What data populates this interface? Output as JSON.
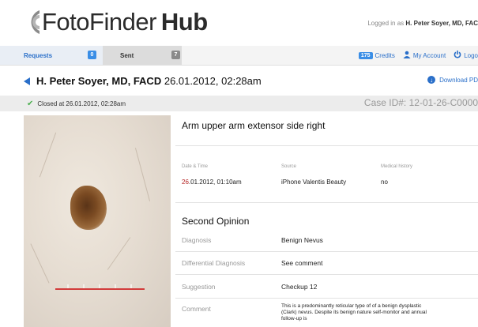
{
  "header": {
    "logo_text": "FotoFinder",
    "logo_bold": "Hub",
    "logged_prefix": "Logged in as",
    "logged_user": "H. Peter Soyer, MD, FAC"
  },
  "tabs": [
    {
      "label": "Requests",
      "count": "0"
    },
    {
      "label": "Sent",
      "count": "7"
    }
  ],
  "topnav": {
    "credits_count": "175",
    "credits_label": "Credits",
    "account_label": "My Account",
    "logout_label": "Logo"
  },
  "title": {
    "name": "H. Peter Soyer, MD, FACD",
    "datetime": "26.01.2012, 02:28am",
    "download_label": "Download PD"
  },
  "status": {
    "closed_text": "Closed at 26.01.2012, 02:28am",
    "case_id": "Case ID#: 12-01-26-C0000"
  },
  "details": {
    "location": "Arm upper arm extensor side right",
    "meta_headers": [
      "Date & Time",
      "Source",
      "Medical history"
    ],
    "date_red": "26",
    "date_rest": ".01.2012, 01:10am",
    "source": "iPhone Valentis Beauty",
    "medical_history": "no"
  },
  "second_opinion": {
    "title": "Second Opinion",
    "rows": [
      {
        "label": "Diagnosis",
        "value": "Benign Nevus"
      },
      {
        "label": "Differential Diagnosis",
        "value": "See comment"
      },
      {
        "label": "Suggestion",
        "value": "Checkup 12"
      }
    ],
    "comment_label": "Comment",
    "comment_text": "This is a predominantly reticular type of of a benign dysplastic (Clark) nevus. Despite its benign nature self-monitor and annual follow-up is"
  },
  "colors": {
    "accent": "#2a6fc9",
    "badge": "#3a8ee6",
    "scale": "#d23b3b",
    "check": "#4caf50"
  },
  "icons": [
    "logo-mark-icon",
    "back-arrow-icon",
    "user-icon",
    "power-icon",
    "download-icon",
    "check-icon"
  ]
}
